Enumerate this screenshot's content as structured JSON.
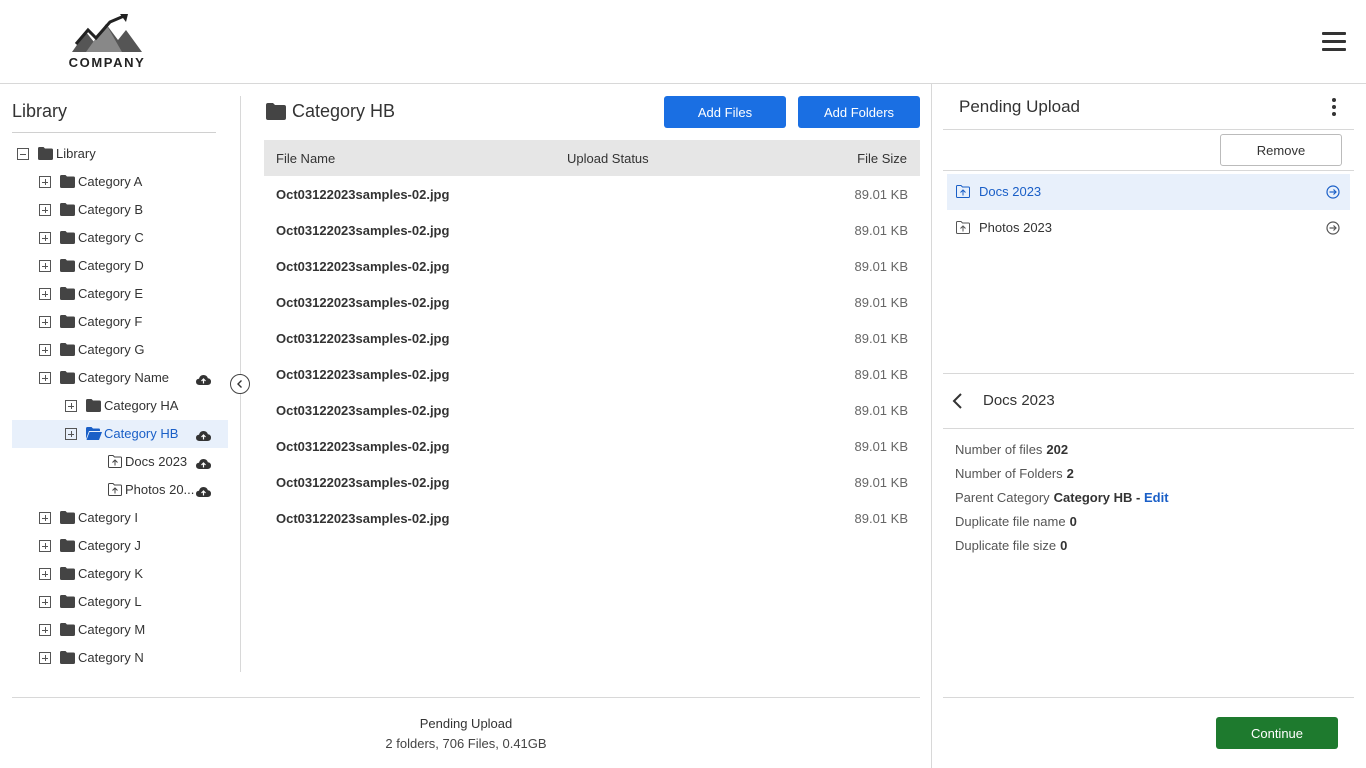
{
  "header": {
    "logo_text": "COMPANY"
  },
  "library": {
    "title": "Library",
    "tree": [
      {
        "label": "Library"
      },
      {
        "label": "Category A"
      },
      {
        "label": "Category B"
      },
      {
        "label": "Category C"
      },
      {
        "label": "Category D"
      },
      {
        "label": "Category E"
      },
      {
        "label": "Category F"
      },
      {
        "label": "Category G"
      },
      {
        "label": "Category Name"
      },
      {
        "label": "Category HA"
      },
      {
        "label": "Category HB"
      },
      {
        "label": "Docs 2023"
      },
      {
        "label": "Photos 20..."
      },
      {
        "label": "Category I"
      },
      {
        "label": "Category J"
      },
      {
        "label": "Category K"
      },
      {
        "label": "Category L"
      },
      {
        "label": "Category M"
      },
      {
        "label": "Category N"
      }
    ]
  },
  "main": {
    "title": "Category HB",
    "add_files_label": "Add Files",
    "add_folders_label": "Add Folders",
    "columns": {
      "name": "File Name",
      "status": "Upload Status",
      "size": "File Size"
    },
    "files": [
      {
        "name": "Oct03122023samples-02.jpg",
        "size": "89.01 KB"
      },
      {
        "name": "Oct03122023samples-02.jpg",
        "size": "89.01 KB"
      },
      {
        "name": "Oct03122023samples-02.jpg",
        "size": "89.01 KB"
      },
      {
        "name": "Oct03122023samples-02.jpg",
        "size": "89.01 KB"
      },
      {
        "name": "Oct03122023samples-02.jpg",
        "size": "89.01 KB"
      },
      {
        "name": "Oct03122023samples-02.jpg",
        "size": "89.01 KB"
      },
      {
        "name": "Oct03122023samples-02.jpg",
        "size": "89.01 KB"
      },
      {
        "name": "Oct03122023samples-02.jpg",
        "size": "89.01 KB"
      },
      {
        "name": "Oct03122023samples-02.jpg",
        "size": "89.01 KB"
      },
      {
        "name": "Oct03122023samples-02.jpg",
        "size": "89.01 KB"
      }
    ]
  },
  "footer": {
    "title": "Pending Upload",
    "summary": "2 folders, 706 Files, 0.41GB"
  },
  "pending": {
    "title": "Pending Upload",
    "remove_label": "Remove",
    "items": [
      {
        "label": "Docs 2023"
      },
      {
        "label": "Photos 2023"
      }
    ],
    "details": {
      "title": "Docs 2023",
      "num_files_label": "Number of files",
      "num_files": "202",
      "num_folders_label": "Number of Folders",
      "num_folders": "2",
      "parent_label": "Parent Category",
      "parent": "Category HB -",
      "edit_label": "Edit",
      "dup_name_label": "Duplicate file name",
      "dup_name": "0",
      "dup_size_label": "Duplicate file size",
      "dup_size": "0"
    },
    "continue_label": "Continue"
  },
  "colors": {
    "accent": "#1a6fe3",
    "selected_text": "#1a5fc7",
    "selected_bg": "#e8f0fb",
    "continue": "#1e7a2e"
  },
  "icons": [
    "hamburger-menu-icon",
    "folder-icon",
    "open-folder-icon",
    "cloud-upload-icon",
    "folder-upload-icon",
    "chevron-left-icon",
    "arrow-right-circle-icon",
    "kebab-menu-icon"
  ]
}
